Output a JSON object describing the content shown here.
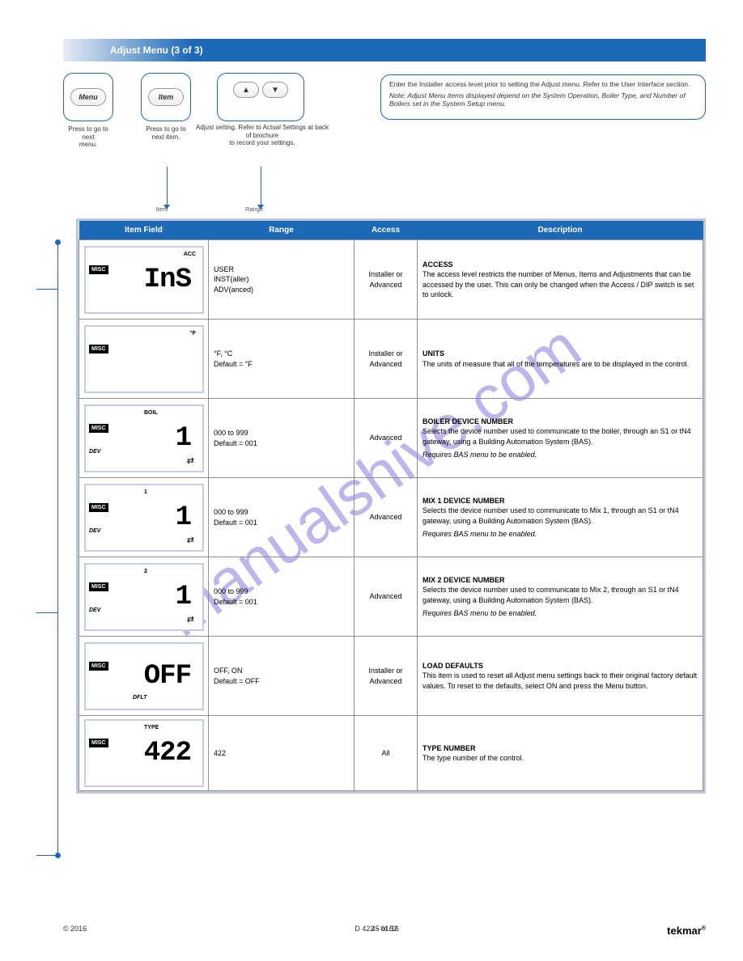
{
  "watermark": "manualshive.com",
  "section_title": "Adjust Menu (3 of 3)",
  "buttons": {
    "menu": {
      "label": "Menu",
      "legend_line1": "Press to go to next",
      "legend_line2": "menu."
    },
    "item": {
      "label": "Item",
      "legend_line1": "Press to go to",
      "legend_line2": "next item."
    },
    "arrows": {
      "up_symbol": "▲",
      "down_symbol": "▼",
      "legend_line1": "Adjust setting. Refer to Actual Settings at back of brochure",
      "legend_line2": "to record your settings."
    }
  },
  "desc_box": {
    "line1": "Enter the Installer access level prior to setting the Adjust menu. Refer to the User Interface section.",
    "line2": "Note: Adjust Menu items displayed depend on the System Operation, Boiler Type, and Number of Boilers set in the System Setup menu."
  },
  "col_small": {
    "item": "Item",
    "range": "Range"
  },
  "table": {
    "headers": [
      "Item Field",
      "Range",
      "Access",
      "Description"
    ],
    "rows": [
      {
        "lcd": {
          "misc": "MISC",
          "flag_top": "ACC",
          "digits": "InS"
        },
        "range": "USER\nINST(aller)\nADV(anced)",
        "access": "Installer or Advanced",
        "desc_title": "ACCESS",
        "desc_body": "The access level restricts the number of Menus, Items and Adjustments that can be accessed by the user. This can only be changed when the Access / DIP switch is set to unlock."
      },
      {
        "lcd": {
          "misc": "MISC",
          "flag_top": "°F",
          "digits": ""
        },
        "range": "°F, °C\nDefault = °F",
        "access": "Installer or Advanced",
        "desc_title": "UNITS",
        "desc_body": "The units of measure that all of the temperatures are to be displayed in the control."
      },
      {
        "lcd": {
          "misc": "MISC",
          "dev": "DEV",
          "flag_sup": "BOIL",
          "digits": "1",
          "netarrow": "⇄"
        },
        "range": "000 to 999\nDefault = 001",
        "access": "Advanced",
        "desc_title": "BOILER DEVICE NUMBER",
        "desc_body": "Selects the device number used to communicate to the boiler, through an S1 or tN4 gateway, using a Building Automation System (BAS).",
        "desc_req": "Requires BAS menu to be enabled."
      },
      {
        "lcd": {
          "misc": "MISC",
          "dev": "DEV",
          "flag_sup": "1",
          "digits": "1",
          "netarrow": "⇄"
        },
        "range": "000 to 999\nDefault = 001",
        "access": "Advanced",
        "desc_title": "MIX 1 DEVICE NUMBER",
        "desc_body": "Selects the device number used to communicate to Mix 1, through an S1 or tN4 gateway, using a Building Automation System (BAS).",
        "desc_req": "Requires BAS menu to be enabled."
      },
      {
        "lcd": {
          "misc": "MISC",
          "dev": "DEV",
          "flag_sup": "2",
          "digits": "1",
          "netarrow": "⇄"
        },
        "range": "000 to 999\nDefault = 001",
        "access": "Advanced",
        "desc_title": "MIX 2 DEVICE NUMBER",
        "desc_body": "Selects the device number used to communicate to Mix 2, through an S1 or tN4 gateway, using a Building Automation System (BAS).",
        "desc_req": "Requires BAS menu to be enabled."
      },
      {
        "lcd": {
          "misc": "MISC",
          "dflt": "DFLT",
          "digits": "OFF"
        },
        "range": "OFF, ON\nDefault = OFF",
        "access": "Installer or Advanced",
        "desc_title": "LOAD DEFAULTS",
        "desc_body": "This item is used to reset all Adjust menu settings back to their original factory default values. To reset to the defaults, select ON and press the Menu button."
      },
      {
        "lcd": {
          "misc": "MISC",
          "flag_sup": "TYPE",
          "digits": "422"
        },
        "range": "422",
        "access": "All",
        "desc_title": "TYPE NUMBER",
        "desc_body": "The type number of the control."
      }
    ]
  },
  "footer": {
    "copyright": "© 2016",
    "product": "D 422 - 01/16",
    "page": "45 of 52",
    "brand": "tekmar"
  }
}
